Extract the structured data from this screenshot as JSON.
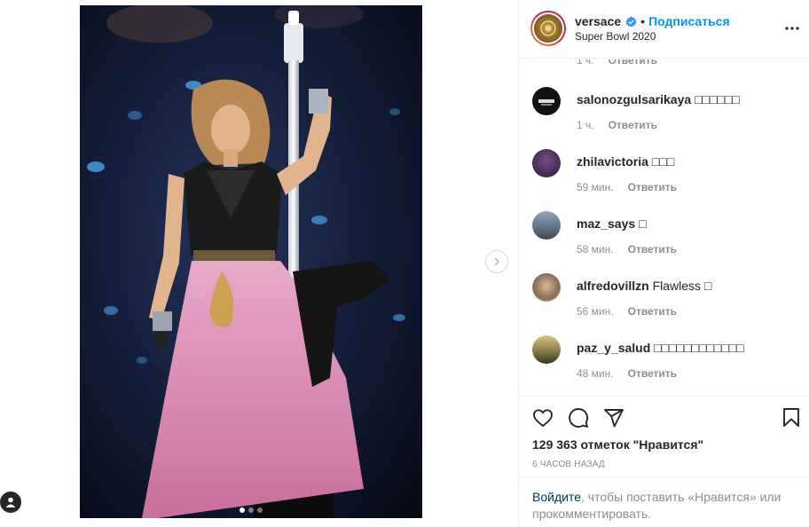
{
  "post": {
    "slide_index": 1,
    "slide_count": 3
  },
  "header": {
    "username": "versace",
    "separator": "•",
    "follow_label": "Подписаться",
    "location": "Super Bowl 2020"
  },
  "partial_comment": {
    "time": "1 ч.",
    "reply_label": "Ответить"
  },
  "comments": [
    {
      "user": "salonozgulsarikaya",
      "text": "□□□□□□",
      "time": "1 ч.",
      "reply_label": "Ответить"
    },
    {
      "user": "zhilavictoria",
      "text": "□□□",
      "time": "59 мин.",
      "reply_label": "Ответить"
    },
    {
      "user": "maz_says",
      "text": "□",
      "time": "58 мин.",
      "reply_label": "Ответить"
    },
    {
      "user": "alfredovillzn",
      "text": "Flawless □",
      "time": "56 мин.",
      "reply_label": "Ответить"
    },
    {
      "user": "paz_y_salud",
      "text": "□□□□□□□□□□□□",
      "time": "48 мин.",
      "reply_label": "Ответить"
    }
  ],
  "stats": {
    "likes_text": "129 363 отметок \"Нравится\"",
    "time_ago": "6 ЧАСОВ НАЗАД"
  },
  "login_prompt": {
    "link_label": "Войдите",
    "rest_text": ", чтобы поставить «Нравится» или прокомментировать."
  },
  "icons": {
    "like": "heart-icon",
    "comment": "comment-icon",
    "share": "paper-plane-icon",
    "save": "bookmark-icon",
    "more": "more-dots-icon",
    "verified": "verified-badge-icon",
    "next": "chevron-right-icon"
  },
  "colors": {
    "accent": "#0095f6",
    "verified": "#3897f0",
    "muted": "#8e8e8e",
    "link": "#00376b"
  }
}
